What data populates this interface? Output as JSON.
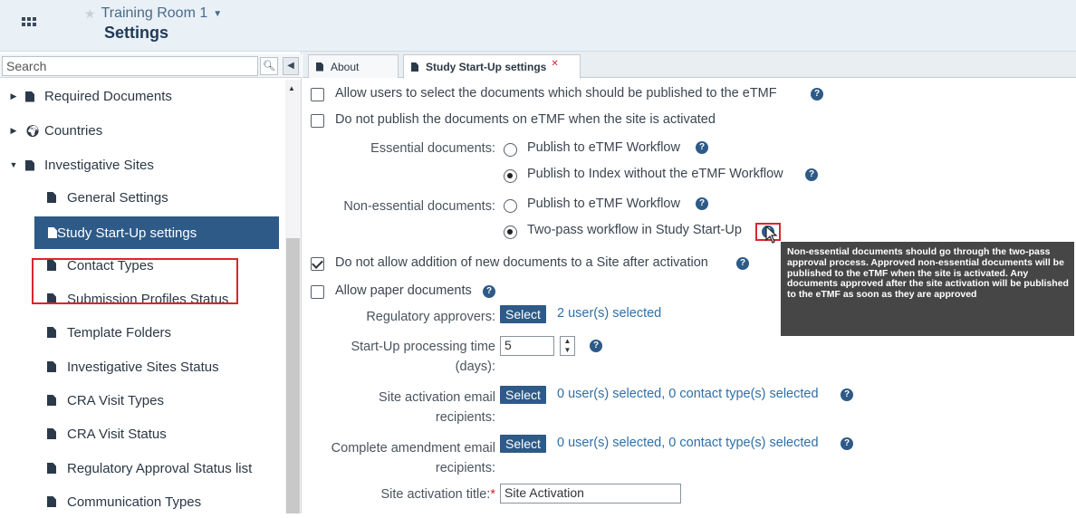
{
  "header": {
    "room_name": "Training Room 1",
    "title": "Settings"
  },
  "sidebar": {
    "search_placeholder": "Search",
    "items": [
      {
        "label": "Required Documents"
      },
      {
        "label": "Countries"
      },
      {
        "label": "Investigative Sites"
      },
      {
        "label": "General Settings"
      },
      {
        "label": "Study Start-Up settings"
      },
      {
        "label": "Contact Types"
      },
      {
        "label": "Submission Profiles Status"
      },
      {
        "label": "Template Folders"
      },
      {
        "label": "Investigative Sites Status"
      },
      {
        "label": "CRA Visit Types"
      },
      {
        "label": "CRA Visit Status"
      },
      {
        "label": "Regulatory Approval Status list"
      },
      {
        "label": "Communication Types"
      }
    ]
  },
  "tabs": [
    {
      "label": "About"
    },
    {
      "label": "Study Start-Up settings"
    }
  ],
  "form": {
    "allow_select_docs": "Allow users to select the documents which should be published to the eTMF",
    "no_publish_on_activation": "Do not publish the documents on eTMF when the site is activated",
    "essential_label": "Essential documents:",
    "essential_opt1": "Publish to eTMF Workflow",
    "essential_opt2": "Publish to Index without the eTMF Workflow",
    "nonessential_label": "Non-essential documents:",
    "nonessential_opt1": "Publish to eTMF Workflow",
    "nonessential_opt2": "Two-pass workflow in Study Start-Up",
    "no_new_docs": "Do not allow addition of new documents to a Site after activation",
    "allow_paper": "Allow paper documents",
    "reg_approvers_label": "Regulatory approvers:",
    "select_label": "Select",
    "reg_approvers_value": "2 user(s) selected",
    "processing_time_label_1": "Start-Up processing time",
    "processing_time_label_2": "(days):",
    "processing_time_value": "5",
    "activation_email_label_1": "Site activation email",
    "activation_email_label_2": "recipients:",
    "activation_email_value": "0 user(s) selected, 0 contact type(s) selected",
    "amendment_email_label_1": "Complete amendment email",
    "amendment_email_label_2": "recipients:",
    "amendment_email_value": "0 user(s) selected, 0 contact type(s) selected",
    "activation_title_label": "Site activation title:",
    "activation_title_value": "Site Activation"
  },
  "tooltip": {
    "text": "Non-essential documents should go through the two-pass approval process. Approved non-essential documents will be published to the eTMF when the site is activated. Any documents approved after the site activation will be published to the eTMF as soon as they are approved"
  },
  "colors": {
    "accent": "#2e5a87",
    "highlight": "#d9262c",
    "tooltip_bg": "#464646"
  }
}
